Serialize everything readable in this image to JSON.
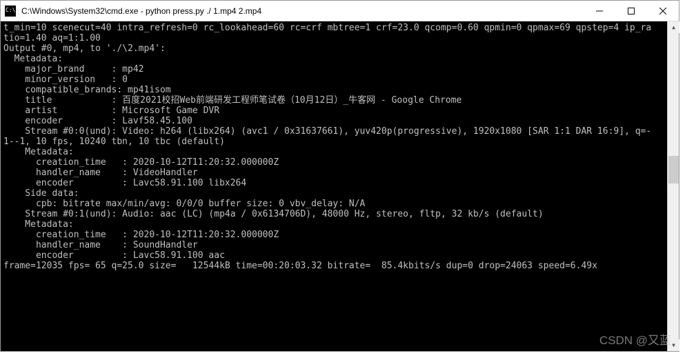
{
  "window": {
    "title": "C:\\Windows\\System32\\cmd.exe - python  press.py ./ 1.mp4 2.mp4"
  },
  "terminal": {
    "lines": [
      "t_min=10 scenecut=40 intra_refresh=0 rc_lookahead=60 rc=crf mbtree=1 crf=23.0 qcomp=0.60 qpmin=0 qpmax=69 qpstep=4 ip_ra",
      "tio=1.40 aq=1:1.00",
      "Output #0, mp4, to './\\2.mp4':",
      "  Metadata:",
      "    major_brand     : mp42",
      "    minor_version   : 0",
      "    compatible_brands: mp41isom",
      "    title           : 百度2021校招Web前端研发工程师笔试卷（10月12日）_牛客网 - Google Chrome",
      "    artist          : Microsoft Game DVR",
      "    encoder         : Lavf58.45.100",
      "    Stream #0:0(und): Video: h264 (libx264) (avc1 / 0x31637661), yuv420p(progressive), 1920x1080 [SAR 1:1 DAR 16:9], q=-",
      "1--1, 10 fps, 10240 tbn, 10 tbc (default)",
      "    Metadata:",
      "      creation_time   : 2020-10-12T11:20:32.000000Z",
      "      handler_name    : VideoHandler",
      "      encoder         : Lavc58.91.100 libx264",
      "    Side data:",
      "      cpb: bitrate max/min/avg: 0/0/0 buffer size: 0 vbv_delay: N/A",
      "    Stream #0:1(und): Audio: aac (LC) (mp4a / 0x6134706D), 48000 Hz, stereo, fltp, 32 kb/s (default)",
      "    Metadata:",
      "      creation_time   : 2020-10-12T11:20:32.000000Z",
      "      handler_name    : SoundHandler",
      "      encoder         : Lavc58.91.100 aac",
      "frame=12035 fps= 65 q=25.0 size=   12544kB time=00:20:03.32 bitrate=  85.4kbits/s dup=0 drop=24063 speed=6.49x"
    ]
  },
  "watermark": "CSDN @又蓝"
}
